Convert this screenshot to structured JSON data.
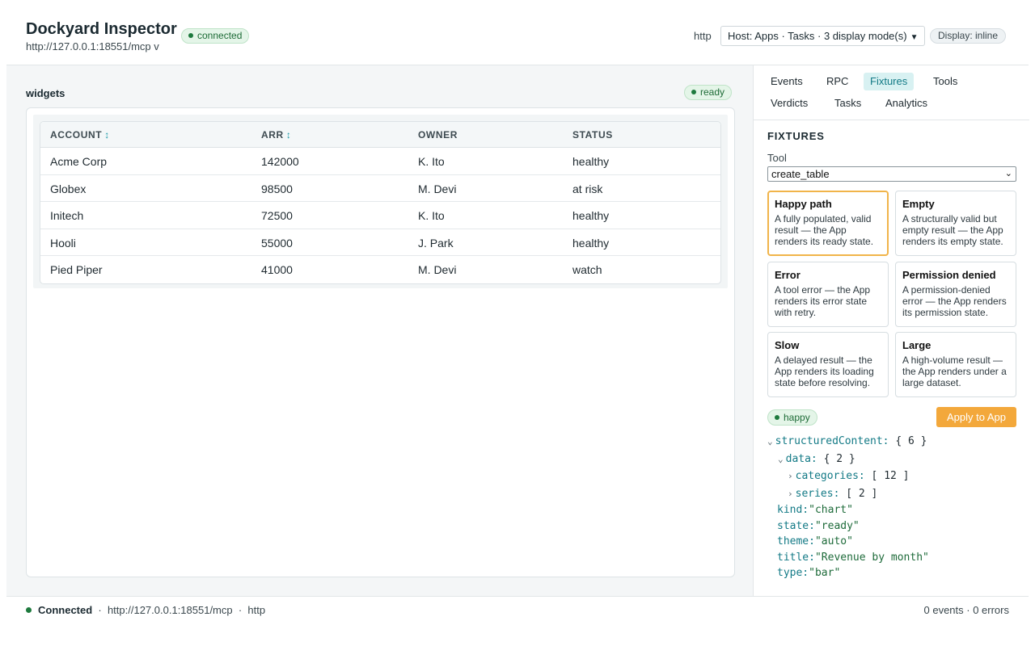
{
  "header": {
    "title": "Dockyard Inspector",
    "server_url": "http://127.0.0.1:18551/mcp v",
    "connection_badge": "connected",
    "transport": "http",
    "host_select": "Host: Apps · Tasks · 3 display mode(s)",
    "display_badge": "Display: inline"
  },
  "main": {
    "label": "widgets",
    "state_badge": "ready",
    "table": {
      "columns": [
        "ACCOUNT",
        "ARR",
        "OWNER",
        "STATUS"
      ],
      "sortable_icon": "↕",
      "rows": [
        [
          "Acme Corp",
          "142000",
          "K. Ito",
          "healthy"
        ],
        [
          "Globex",
          "98500",
          "M. Devi",
          "at risk"
        ],
        [
          "Initech",
          "72500",
          "K. Ito",
          "healthy"
        ],
        [
          "Hooli",
          "55000",
          "J. Park",
          "healthy"
        ],
        [
          "Pied Piper",
          "41000",
          "M. Devi",
          "watch"
        ]
      ]
    }
  },
  "sidebar": {
    "tabs": [
      "Events",
      "RPC",
      "Fixtures",
      "Tools",
      "Verdicts",
      "Tasks",
      "Analytics"
    ],
    "active_tab": "Fixtures",
    "section_title": "FIXTURES",
    "tool_label": "Tool",
    "tool_value": "create_table",
    "cards": [
      {
        "title": "Happy path",
        "desc": "A fully populated, valid result — the App renders its ready state."
      },
      {
        "title": "Empty",
        "desc": "A structurally valid but empty result — the App renders its empty state."
      },
      {
        "title": "Error",
        "desc": "A tool error — the App renders its error state with retry."
      },
      {
        "title": "Permission denied",
        "desc": "A permission-denied error — the App renders its permission state."
      },
      {
        "title": "Slow",
        "desc": "A delayed result — the App renders its loading state before resolving."
      },
      {
        "title": "Large",
        "desc": "A high-volume result — the App renders under a large dataset."
      }
    ],
    "selected_badge": "happy",
    "apply_button": "Apply to App",
    "json_tree": {
      "structuredContent_key": "structuredContent:",
      "structuredContent_val": "{ 6 }",
      "data_key": "data:",
      "data_val": "{ 2 }",
      "categories_key": "categories:",
      "categories_val": "[ 12 ]",
      "series_key": "series:",
      "series_val": "[ 2 ]",
      "kind_key": "kind:",
      "kind_val": "\"chart\"",
      "state_key": "state:",
      "state_val": "\"ready\"",
      "theme_key": "theme:",
      "theme_val": "\"auto\"",
      "title_key": "title:",
      "title_val": "\"Revenue by month\"",
      "type_key": "type:",
      "type_val": "\"bar\""
    }
  },
  "statusbar": {
    "connection": "Connected",
    "url": "http://127.0.0.1:18551/mcp",
    "transport": "http",
    "counts": "0 events · 0 errors"
  },
  "colors": {
    "accent": "#137a86",
    "success": "#1e7a3e",
    "apply": "#f3a83b",
    "selected_border": "#f1b44a"
  }
}
